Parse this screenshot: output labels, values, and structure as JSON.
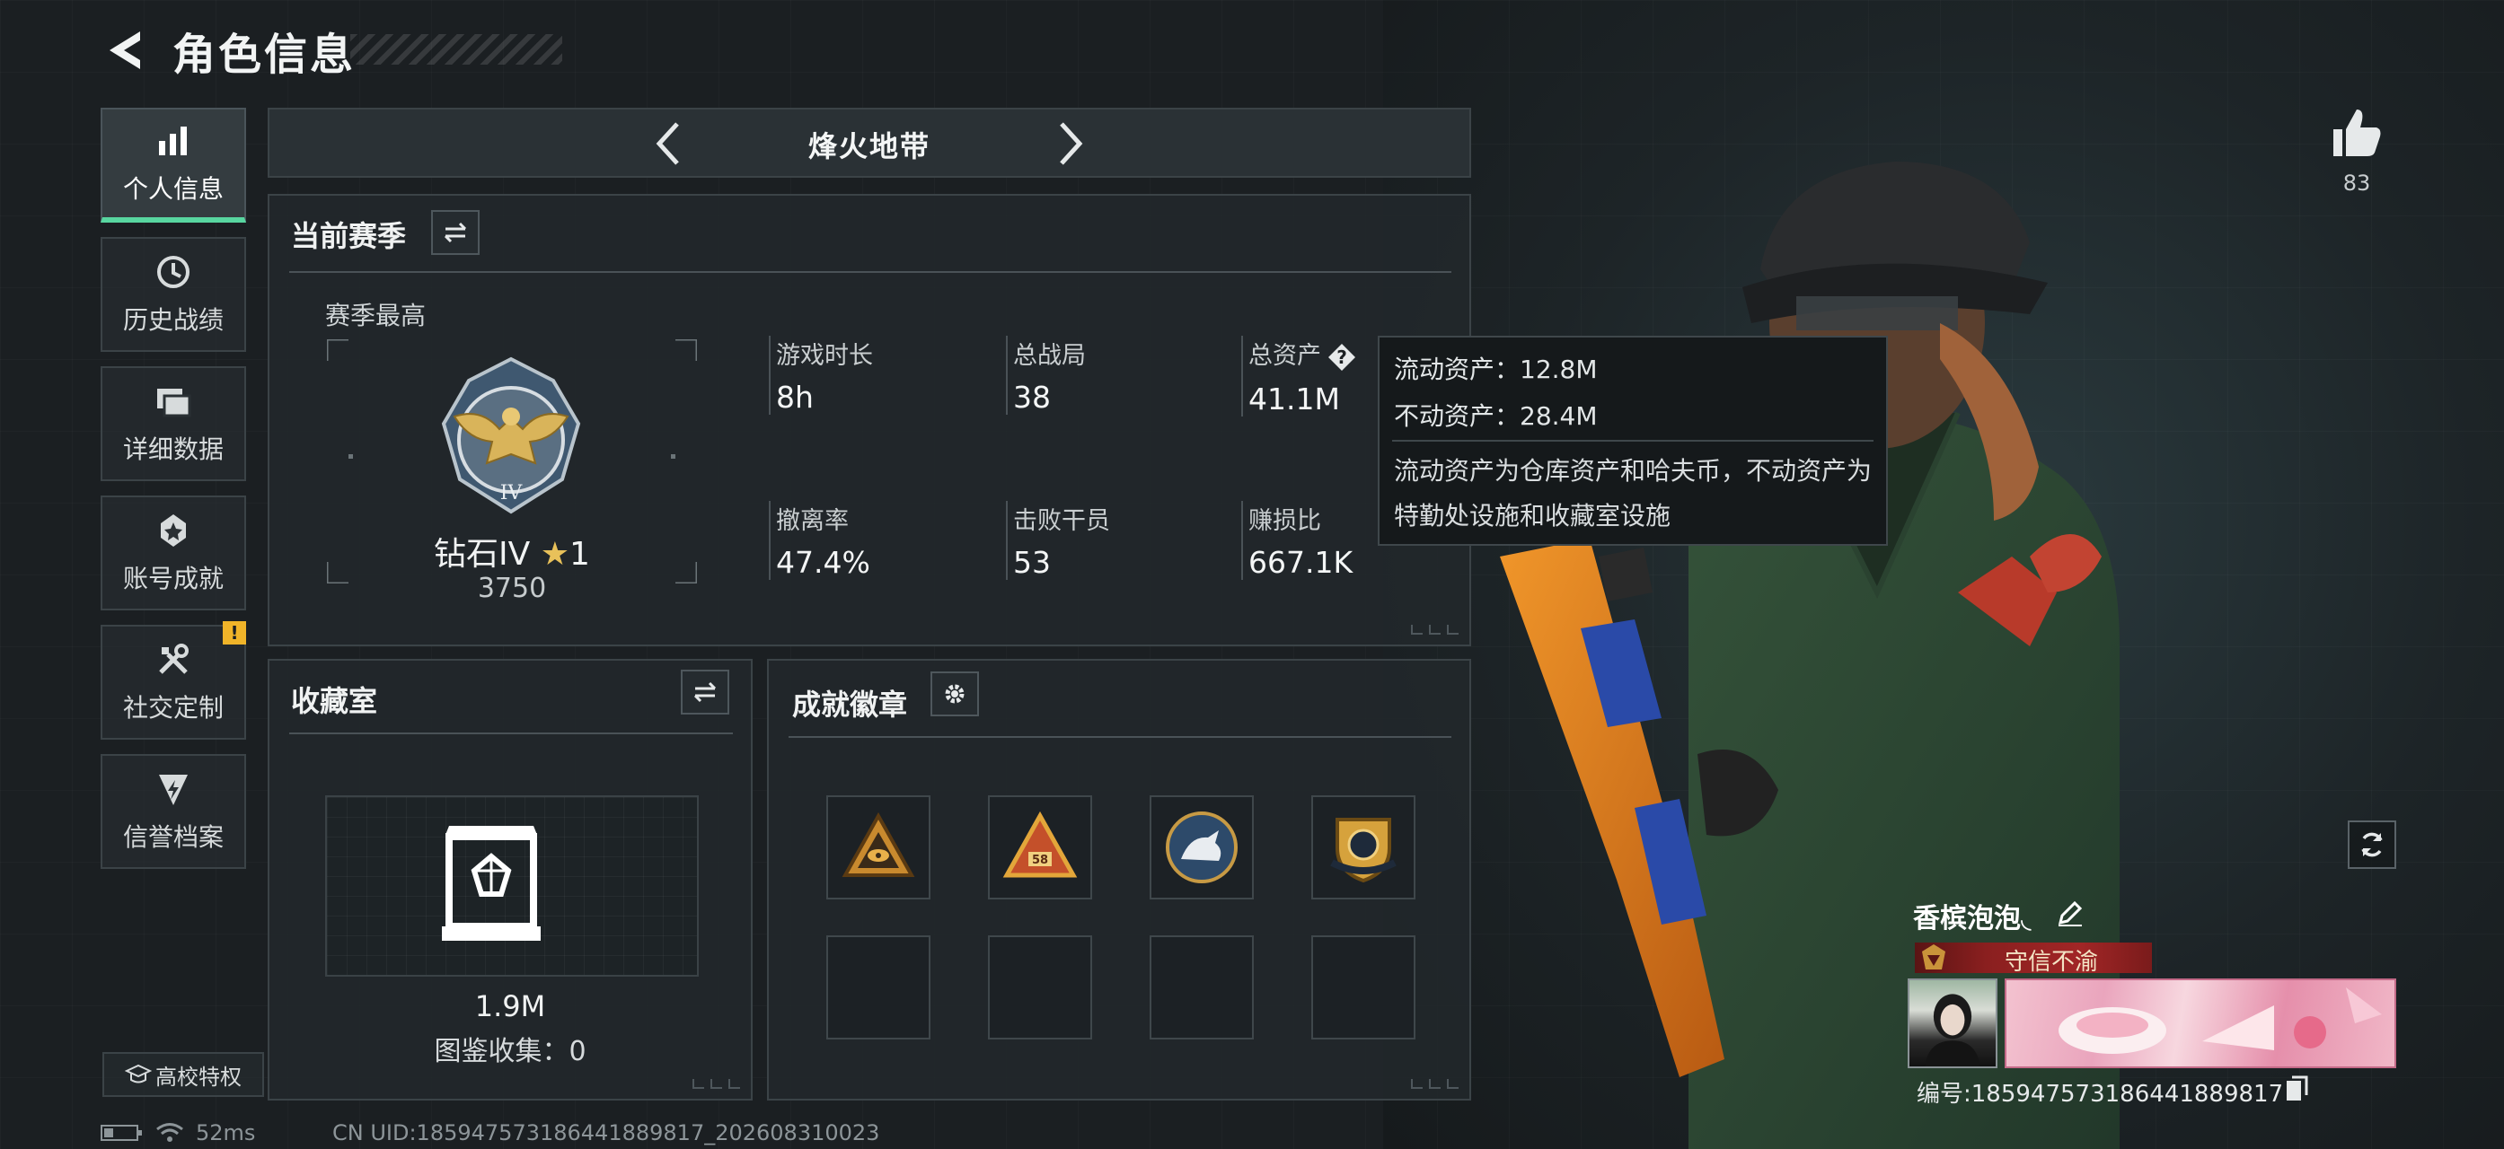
{
  "header": {
    "title": "角色信息"
  },
  "sidebar": {
    "items": [
      {
        "label": "个人信息",
        "icon": "bar-chart-icon",
        "active": true
      },
      {
        "label": "历史战绩",
        "icon": "history-clock-icon"
      },
      {
        "label": "详细数据",
        "icon": "folders-icon"
      },
      {
        "label": "账号成就",
        "icon": "achievement-icon"
      },
      {
        "label": "社交定制",
        "icon": "tools-icon",
        "badge": "!"
      },
      {
        "label": "信誉档案",
        "icon": "credit-shield-icon"
      }
    ],
    "school_button": "高校特权"
  },
  "mode": {
    "title": "烽火地带"
  },
  "season": {
    "title": "当前赛季",
    "best_label": "赛季最高",
    "rank_name": "钻石IV",
    "rank_star": "★",
    "rank_stars_count": "1",
    "rank_score": "3750",
    "stats": [
      {
        "label": "游戏时长",
        "value": "8h"
      },
      {
        "label": "总战局",
        "value": "38"
      },
      {
        "label": "总资产",
        "value": "41.1M"
      },
      {
        "label": "撤离率",
        "value": "47.4%"
      },
      {
        "label": "击败干员",
        "value": "53"
      },
      {
        "label": "赚损比",
        "value": "667.1K"
      }
    ]
  },
  "tooltip": {
    "liquid": "流动资产：12.8M",
    "fixed": "不动资产：28.4M",
    "description": "流动资产为仓库资产和哈夫币，不动资产为特勤处设施和收藏室设施"
  },
  "collection": {
    "title": "收藏室",
    "value": "1.9M",
    "count": "图鉴收集：0"
  },
  "badges": {
    "title": "成就徽章",
    "slots": [
      "triangle-eye-badge",
      "triangle-58-badge",
      "round-rhino-badge",
      "shield-crest-badge",
      "",
      "",
      "",
      ""
    ]
  },
  "profile": {
    "likes": "83",
    "name": "香槟泡泡◟",
    "tag": "守信不渝",
    "id": "编号:1859475731864418898​17"
  },
  "status": {
    "ping": "52ms",
    "uid": "CN UID:1859475731864418898​17_202608310023"
  },
  "colors": {
    "accent": "#58d6a0",
    "panel": "#22282c",
    "tag_red": "#a12626",
    "warning": "#f0b429"
  }
}
